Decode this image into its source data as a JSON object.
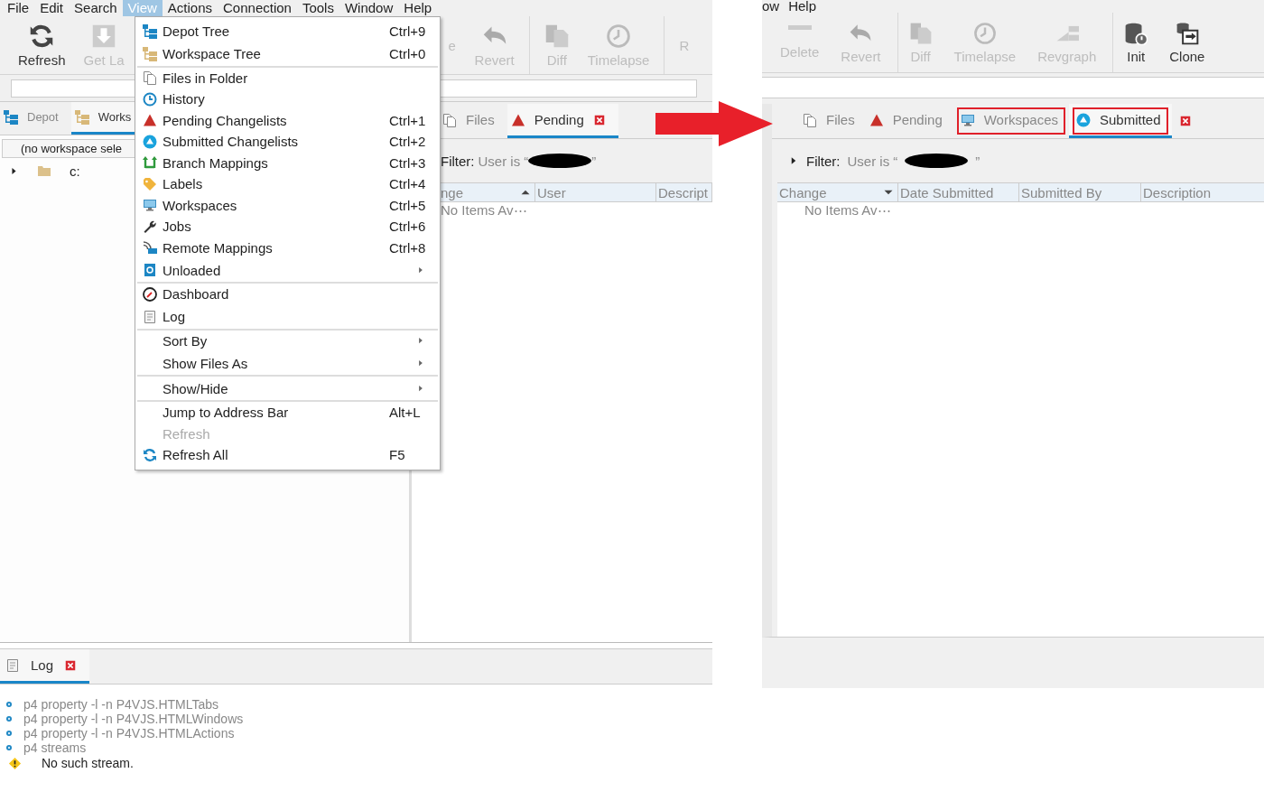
{
  "left_window": {
    "menu_bar": [
      {
        "label": "File",
        "selected": false
      },
      {
        "label": "Edit",
        "selected": false
      },
      {
        "label": "Search",
        "selected": false
      },
      {
        "label": "View",
        "selected": true
      },
      {
        "label": "Actions",
        "selected": false
      },
      {
        "label": "Connection",
        "selected": false
      },
      {
        "label": "Tools",
        "selected": false
      },
      {
        "label": "Window",
        "selected": false
      },
      {
        "label": "Help",
        "selected": false
      }
    ],
    "toolbar": [
      {
        "label": "Refresh",
        "kind": "refresh",
        "disabled": false,
        "separator_before": false
      },
      {
        "label": "Get La",
        "kind": "get",
        "disabled": true,
        "separator_before": false
      },
      {
        "label": "e",
        "kind": "none",
        "disabled": true,
        "separator_before": false
      },
      {
        "label": "Revert",
        "kind": "revert",
        "disabled": true,
        "separator_before": false
      },
      {
        "label": "Diff",
        "kind": "diff",
        "disabled": true,
        "separator_before": true
      },
      {
        "label": "Timelapse",
        "kind": "timelapse",
        "disabled": true,
        "separator_before": false
      },
      {
        "label": "R",
        "kind": "none",
        "disabled": true,
        "separator_before": true
      }
    ],
    "left_pane": {
      "tabs": [
        {
          "label": "Depot",
          "kind": "depot",
          "selected": false
        },
        {
          "label": "Works",
          "kind": "wstree",
          "selected": true
        }
      ],
      "workspace_combo": "(no workspace sele",
      "tree": [
        {
          "label": "c:",
          "expanded": false
        }
      ]
    },
    "right_pane": {
      "tabs": [
        {
          "label": "Files",
          "kind": "files",
          "selected": false
        },
        {
          "label": "Pending",
          "kind": "pending",
          "selected": true
        }
      ],
      "filter": {
        "label": "Filter:",
        "prefix": "User is “",
        "suffix": "”",
        "redacted": true
      },
      "columns": [
        {
          "label": "nge",
          "sorted": true,
          "descending": false
        },
        {
          "label": "User",
          "sorted": false
        },
        {
          "label": "Descript",
          "sorted": false
        }
      ],
      "empty_text": "No Items Av⋯"
    },
    "bottom_pane": {
      "tabs": [
        {
          "label": "Log",
          "kind": "log",
          "selected": true
        }
      ],
      "log": [
        {
          "kind": "info",
          "text": "p4 property -l -n P4VJS.HTMLTabs"
        },
        {
          "kind": "info",
          "text": "p4 property -l -n P4VJS.HTMLWindows"
        },
        {
          "kind": "info",
          "text": "p4 property -l -n P4VJS.HTMLActions"
        },
        {
          "kind": "info",
          "text": "p4 streams"
        },
        {
          "kind": "warning",
          "text": "No such stream."
        }
      ]
    },
    "view_menu": [
      {
        "label": "Depot Tree",
        "kind": "depot",
        "shortcut": "Ctrl+9",
        "disabled": false,
        "submenu": false,
        "separator_after": false
      },
      {
        "label": "Workspace Tree",
        "kind": "wstree",
        "shortcut": "Ctrl+0",
        "disabled": false,
        "submenu": false,
        "separator_after": true
      },
      {
        "label": "Files in Folder",
        "kind": "files",
        "disabled": false,
        "submenu": false,
        "separator_after": false
      },
      {
        "label": "History",
        "kind": "history",
        "disabled": false,
        "submenu": false,
        "separator_after": false
      },
      {
        "label": "Pending Changelists",
        "kind": "pending",
        "shortcut": "Ctrl+1",
        "disabled": false,
        "submenu": false,
        "separator_after": false
      },
      {
        "label": "Submitted Changelists",
        "kind": "submitted",
        "shortcut": "Ctrl+2",
        "disabled": false,
        "submenu": false,
        "separator_after": false
      },
      {
        "label": "Branch Mappings",
        "kind": "branch",
        "shortcut": "Ctrl+3",
        "disabled": false,
        "submenu": false,
        "separator_after": false
      },
      {
        "label": "Labels",
        "kind": "label",
        "shortcut": "Ctrl+4",
        "disabled": false,
        "submenu": false,
        "separator_after": false
      },
      {
        "label": "Workspaces",
        "kind": "workspace",
        "shortcut": "Ctrl+5",
        "disabled": false,
        "submenu": false,
        "separator_after": false
      },
      {
        "label": "Jobs",
        "kind": "jobs",
        "shortcut": "Ctrl+6",
        "disabled": false,
        "submenu": false,
        "separator_after": false
      },
      {
        "label": "Remote Mappings",
        "kind": "remote",
        "shortcut": "Ctrl+8",
        "disabled": false,
        "submenu": false,
        "separator_after": false
      },
      {
        "label": "Unloaded",
        "kind": "unloaded",
        "disabled": false,
        "submenu": true,
        "separator_after": true
      },
      {
        "label": "Dashboard",
        "kind": "dashboard",
        "disabled": false,
        "submenu": false,
        "separator_after": false
      },
      {
        "label": "Log",
        "kind": "log",
        "disabled": false,
        "submenu": false,
        "separator_after": true
      },
      {
        "label": "Sort By",
        "kind": "none",
        "disabled": false,
        "submenu": true,
        "separator_after": false
      },
      {
        "label": "Show Files As",
        "kind": "none",
        "disabled": false,
        "submenu": true,
        "separator_after": true
      },
      {
        "label": "Show/Hide",
        "kind": "none",
        "disabled": false,
        "submenu": true,
        "separator_after": true
      },
      {
        "label": "Jump to Address Bar",
        "kind": "none",
        "shortcut": "Alt+L",
        "disabled": false,
        "submenu": false,
        "separator_after": false
      },
      {
        "label": "Refresh",
        "kind": "none",
        "disabled": true,
        "submenu": false,
        "separator_after": false
      },
      {
        "label": "Refresh All",
        "kind": "refreshall",
        "shortcut": "F5",
        "disabled": false,
        "submenu": false,
        "separator_after": false
      }
    ]
  },
  "right_window": {
    "menu_bar": [
      {
        "label": "ow",
        "selected": false
      },
      {
        "label": "Help",
        "selected": false
      }
    ],
    "toolbar": [
      {
        "label": "Delete",
        "kind": "delete",
        "disabled": true,
        "separator_before": false
      },
      {
        "label": "Revert",
        "kind": "revert",
        "disabled": true,
        "separator_before": false
      },
      {
        "label": "Diff",
        "kind": "diff",
        "disabled": true,
        "separator_before": true
      },
      {
        "label": "Timelapse",
        "kind": "timelapse",
        "disabled": true,
        "separator_before": false
      },
      {
        "label": "Revgraph",
        "kind": "revgraph",
        "disabled": true,
        "separator_before": false
      },
      {
        "label": "Init",
        "kind": "init",
        "disabled": false,
        "separator_before": true
      },
      {
        "label": "Clone",
        "kind": "clone",
        "disabled": false,
        "separator_before": false
      }
    ],
    "tabs": [
      {
        "label": "Files",
        "kind": "files",
        "selected": false,
        "highlighted": false
      },
      {
        "label": "Pending",
        "kind": "pending",
        "selected": false,
        "highlighted": false
      },
      {
        "label": "Workspaces",
        "kind": "workspace",
        "selected": false,
        "highlighted": true
      },
      {
        "label": "Submitted",
        "kind": "submitted",
        "selected": true,
        "highlighted": true
      }
    ],
    "filter": {
      "label": "Filter:",
      "prefix": "User is “",
      "suffix": "”",
      "redacted": true
    },
    "columns": [
      {
        "label": "Change",
        "sorted": true,
        "descending": true
      },
      {
        "label": "Date Submitted",
        "sorted": false
      },
      {
        "label": "Submitted By",
        "sorted": false
      },
      {
        "label": "Description",
        "sorted": false
      }
    ],
    "empty_text": "No Items Av⋯"
  }
}
